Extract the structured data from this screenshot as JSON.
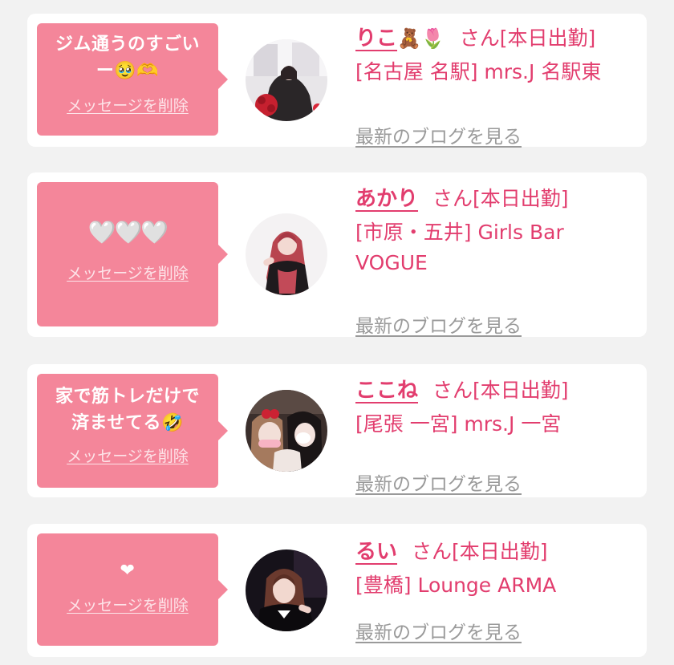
{
  "common": {
    "delete_label": "メッセージを削除",
    "san": "さん",
    "status": "[本日出勤]",
    "blog_label": "最新のブログを見る"
  },
  "colors": {
    "bubble": "#f4869a",
    "accent": "#e23d6e",
    "muted": "#9a9a9a",
    "background": "#f2f2f2",
    "card": "#ffffff"
  },
  "cards": [
    {
      "message_line1": "ジム通うのすごい",
      "message_line2": "ー",
      "message_emoji": "🥹🫶",
      "name": "りこ",
      "name_emoji": "🧸🌷",
      "shop_line1": "[名古屋 名駅] mrs.J 名駅東",
      "shop_line2": ""
    },
    {
      "message_line1": "🤍🤍🤍",
      "message_line2": "",
      "message_emoji": "",
      "name": "あかり",
      "name_emoji": "",
      "shop_line1": "[市原・五井] Girls Bar",
      "shop_line2": "VOGUE"
    },
    {
      "message_line1": "家で筋トレだけで",
      "message_line2": "済ませてる",
      "message_emoji": "🤣",
      "name": "ここね",
      "name_emoji": "",
      "shop_line1": "[尾張 一宮] mrs.J 一宮",
      "shop_line2": ""
    },
    {
      "message_line1": "❤",
      "message_line2": "",
      "message_emoji": "",
      "name": "るい",
      "name_emoji": "",
      "shop_line1": "[豊橋] Lounge ARMA",
      "shop_line2": ""
    }
  ]
}
